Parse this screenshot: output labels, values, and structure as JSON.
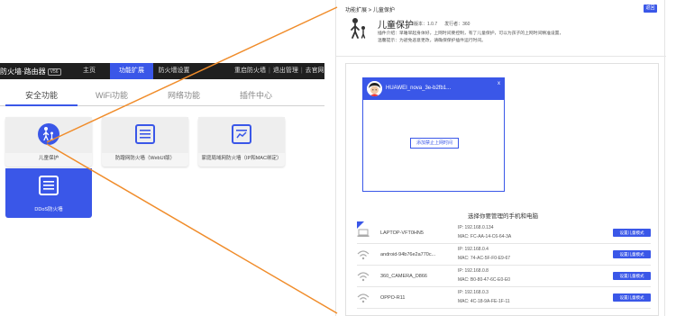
{
  "left": {
    "brand": "防火墙·路由器",
    "version": "V56",
    "nav": [
      "主页",
      "功能扩展",
      "防火墙设置"
    ],
    "actions": [
      "重启防火墙",
      "退出管理",
      "去官网"
    ],
    "subtabs": [
      "安全功能",
      "WiFi功能",
      "网络功能",
      "插件中心"
    ],
    "cards": [
      {
        "label": "儿童保护",
        "icon": "family-icon"
      },
      {
        "label": "防蹭网防火墙（WebUI版）",
        "icon": "firewall-icon"
      },
      {
        "label": "家庭局域网防火墙（IP和MAC绑定）",
        "icon": "lan-firewall-icon"
      },
      {
        "label": "DDoS防火墙",
        "icon": "ddos-icon"
      }
    ]
  },
  "right": {
    "breadcrumb": "功能扩展 >  儿童保护",
    "back_label": "返回",
    "app_title": "儿童保护",
    "version": "版本：1.0.7",
    "author": "发行者：360",
    "desc_line1": "插件介绍：早睡早起身体好，上网时间要控制，有了儿童保护，可以为孩子的上网时间精准设置，",
    "desc_line2": "温馨提示：为避免恶意更改，请确保保护插件运行时间。",
    "popup": {
      "device_name": "HUAWEI_nova_3e-b2fb1...",
      "close": "x",
      "add_button": "添加禁止上网时间"
    },
    "devices_title": "选择你要管理的手机和电脑",
    "devices": [
      {
        "name": "LAPTOP-VFT0HN5",
        "ip": "IP: 192.168.0.134",
        "mac": "MAC: FC-AA-14-C6-64-3A",
        "button": "设置儿童模式",
        "icon": "laptop-icon"
      },
      {
        "name": "android-94b76e2a770c...",
        "ip": "IP: 192.168.0.4",
        "mac": "MAC: 74-AC-5F-F0-E9-67",
        "button": "设置儿童模式",
        "icon": "wifi-icon"
      },
      {
        "name": "360_CAMERA_D866",
        "ip": "IP: 192.168.0.8",
        "mac": "MAC: B0-80-47-6C-E0-E0",
        "button": "设置儿童模式",
        "icon": "wifi-icon"
      },
      {
        "name": "OPPO-R11",
        "ip": "IP: 192.168.0.3",
        "mac": "MAC: 4C-18-9A-FE-1F-11",
        "button": "设置儿童模式",
        "icon": "wifi-icon"
      }
    ]
  },
  "colors": {
    "accent": "#3a57e8",
    "connector": "#f08c2a",
    "topbar": "#1f1f1f"
  }
}
